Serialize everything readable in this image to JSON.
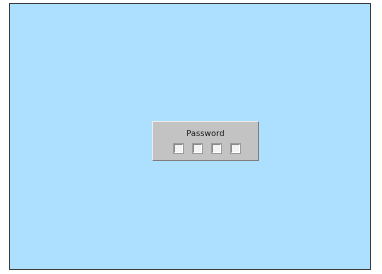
{
  "dialog": {
    "title": "Password",
    "digits": [
      "",
      "",
      "",
      ""
    ]
  },
  "colors": {
    "background": "#ade0ff",
    "dialog": "#c3c3c3",
    "input": "#f3f3f3"
  }
}
